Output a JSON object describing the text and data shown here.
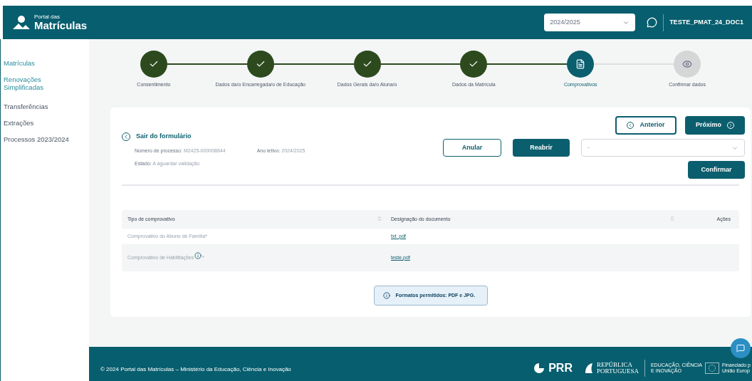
{
  "header": {
    "logo_small": "Portal das",
    "logo_big": "Matrículas",
    "year_select": "2024/2025",
    "user": "TESTE_PMAT_24_DOC1"
  },
  "sidebar": {
    "items": [
      {
        "label": "Matrículas",
        "highlighted": true
      },
      {
        "label": "Renovações Simplificadas",
        "highlighted": true
      },
      {
        "label": "Transferências",
        "highlighted": false
      },
      {
        "label": "Extrações",
        "highlighted": false
      },
      {
        "label": "Processos 2023/2024",
        "highlighted": false
      }
    ]
  },
  "stepper": [
    {
      "label": "Consentimento",
      "kind": "done"
    },
    {
      "label": "Dados da/o Encarregada/o de Educação",
      "kind": "done"
    },
    {
      "label": "Dados Gerais da/o Aluna/o",
      "kind": "done"
    },
    {
      "label": "Dados da Matrícula",
      "kind": "done"
    },
    {
      "label": "Comprovativos",
      "kind": "current"
    },
    {
      "label": "Confirmar dados",
      "kind": "pending"
    }
  ],
  "form": {
    "exit_link": "Sair do formulário",
    "process_label": "Número de processo:",
    "process_value": "M2425-000008644",
    "year_label": "Ano letivo:",
    "year_value": "2024/2025",
    "status_label": "Estado:",
    "status_value": "A aguardar validação",
    "prev_button": "Anterior",
    "next_button": "Próximo",
    "cancel_button": "Anular",
    "reopen_button": "Reabrir",
    "action_select": "-",
    "confirm_button": "Confirmar"
  },
  "table": {
    "columns": [
      "Tipo de comprovativo",
      "Designação do documento",
      "Ações"
    ],
    "rows": [
      {
        "type": "Comprovativo do Abono de Família*",
        "info": false,
        "document": "txt_pdf"
      },
      {
        "type": "Comprovativo de Habilitações",
        "info": true,
        "required_mark": "*",
        "document": "teste.pdf"
      }
    ]
  },
  "notice": "Formatos permitidos: PDF e JPG.",
  "footer": {
    "copyright": "© 2024 Portal das Matrículas – Ministério da Educação, Ciência e Inovação",
    "prr": "PRR",
    "republica": "REPÚBLICA",
    "portuguesa": "PORTUGUESA",
    "ministry": "EDUCAÇÃO, CIÊNCIA E INOVAÇÃO",
    "eu_line1": "Financiado p",
    "eu_line2": "União Europ"
  }
}
